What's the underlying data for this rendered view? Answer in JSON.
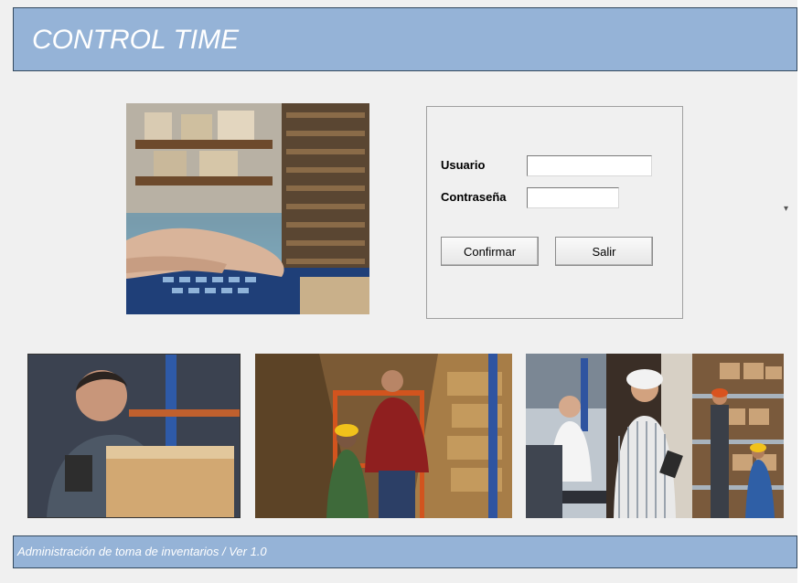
{
  "header": {
    "title": "CONTROL TIME"
  },
  "login": {
    "user_label": "Usuario",
    "password_label": "Contraseña",
    "user_value": "",
    "password_value": "",
    "confirm_label": "Confirmar",
    "exit_label": "Salir"
  },
  "footer": {
    "text": "Administración de toma de inventarios / Ver 1.0"
  },
  "colors": {
    "bar": "#95b3d7",
    "background": "#f0f0f0"
  },
  "photos": [
    "warehouse-keyboard-photo",
    "worker-box-photo",
    "warehouse-aisle-photo",
    "worker-computer-photo",
    "worker-hardhat-photo",
    "warehouse-shelves-photo"
  ]
}
